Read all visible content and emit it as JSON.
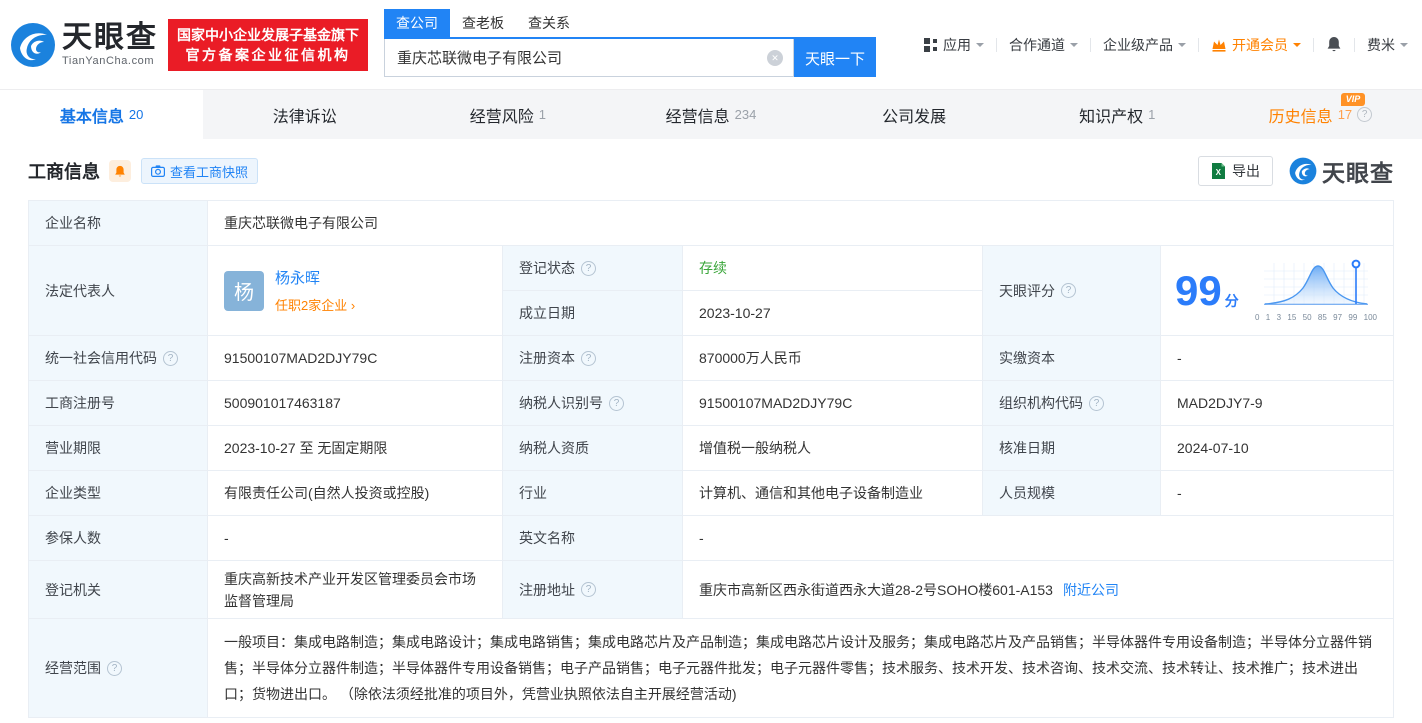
{
  "colors": {
    "primary_blue": "#2184f5",
    "orange": "#ff8201",
    "green": "#3aa63a",
    "badge_red": "#ea1c26",
    "score_blue": "#2b7cfa"
  },
  "header": {
    "brand": "天眼查",
    "brand_domain": "TianYanCha.com",
    "cert_badge_line1": "国家中小企业发展子基金旗下",
    "cert_badge_line2": "官方备案企业征信机构",
    "search_tabs": [
      {
        "label": "查公司"
      },
      {
        "label": "查老板"
      },
      {
        "label": "查关系"
      }
    ],
    "search_value": "重庆芯联微电子有限公司",
    "search_button": "天眼一下",
    "nav": {
      "apps": "应用",
      "partner": "合作通道",
      "enterprise": "企业级产品",
      "vip": "开通会员",
      "user": "费米"
    }
  },
  "tabs": [
    {
      "label": "基本信息",
      "count": "20"
    },
    {
      "label": "法律诉讼",
      "count": ""
    },
    {
      "label": "经营风险",
      "count": "1"
    },
    {
      "label": "经营信息",
      "count": "234"
    },
    {
      "label": "公司发展",
      "count": ""
    },
    {
      "label": "知识产权",
      "count": "1"
    },
    {
      "label": "历史信息",
      "count": "17",
      "vip_badge": "VIP"
    }
  ],
  "section": {
    "title": "工商信息",
    "snapshot_button": "查看工商快照",
    "export_button": "导出",
    "watermark_brand": "天眼查"
  },
  "table": {
    "company_name": {
      "label": "企业名称",
      "value": "重庆芯联微电子有限公司"
    },
    "legal_rep": {
      "label": "法定代表人",
      "avatar_char": "杨",
      "name": "杨永晖",
      "positions_link": "任职2家企业"
    },
    "reg_status": {
      "label": "登记状态",
      "value": "存续"
    },
    "establish_date": {
      "label": "成立日期",
      "value": "2023-10-27"
    },
    "score": {
      "label": "天眼评分",
      "value": "99",
      "unit": "分",
      "axis": [
        "0",
        "1",
        "3",
        "15",
        "50",
        "85",
        "97",
        "99",
        "100"
      ]
    },
    "rows": [
      {
        "c1_label": "统一社会信用代码",
        "c1_value": "91500107MAD2DJY79C",
        "c2_label": "注册资本",
        "c2_value": "870000万人民币",
        "c3_label": "实缴资本",
        "c3_value": "-"
      },
      {
        "c1_label": "工商注册号",
        "c1_value": "500901017463187",
        "c2_label": "纳税人识别号",
        "c2_value": "91500107MAD2DJY79C",
        "c3_label": "组织机构代码",
        "c3_value": "MAD2DJY7-9"
      },
      {
        "c1_label": "营业期限",
        "c1_value": "2023-10-27 至 无固定期限",
        "c2_label": "纳税人资质",
        "c2_value": "增值税一般纳税人",
        "c3_label": "核准日期",
        "c3_value": "2024-07-10"
      },
      {
        "c1_label": "企业类型",
        "c1_value": "有限责任公司(自然人投资或控股)",
        "c2_label": "行业",
        "c2_value": "计算机、通信和其他电子设备制造业",
        "c3_label": "人员规模",
        "c3_value": "-"
      }
    ],
    "insured": {
      "label": "参保人数",
      "value": "-"
    },
    "english_name": {
      "label": "英文名称",
      "value": "-"
    },
    "reg_authority": {
      "label": "登记机关",
      "value": "重庆高新技术产业开发区管理委员会市场监督管理局"
    },
    "reg_address": {
      "label": "注册地址",
      "value": "重庆市高新区西永街道西永大道28-2号SOHO楼601-A153",
      "nearby_link": "附近公司"
    },
    "business_scope": {
      "label": "经营范围",
      "value": "一般项目：集成电路制造；集成电路设计；集成电路销售；集成电路芯片及产品制造；集成电路芯片设计及服务；集成电路芯片及产品销售；半导体器件专用设备制造；半导体分立器件销售；半导体分立器件制造；半导体器件专用设备销售；电子产品销售；电子元器件批发；电子元器件零售；技术服务、技术开发、技术咨询、技术交流、技术转让、技术推广；技术进出口；货物进出口。 （除依法须经批准的项目外，凭营业执照依法自主开展经营活动)"
    }
  }
}
